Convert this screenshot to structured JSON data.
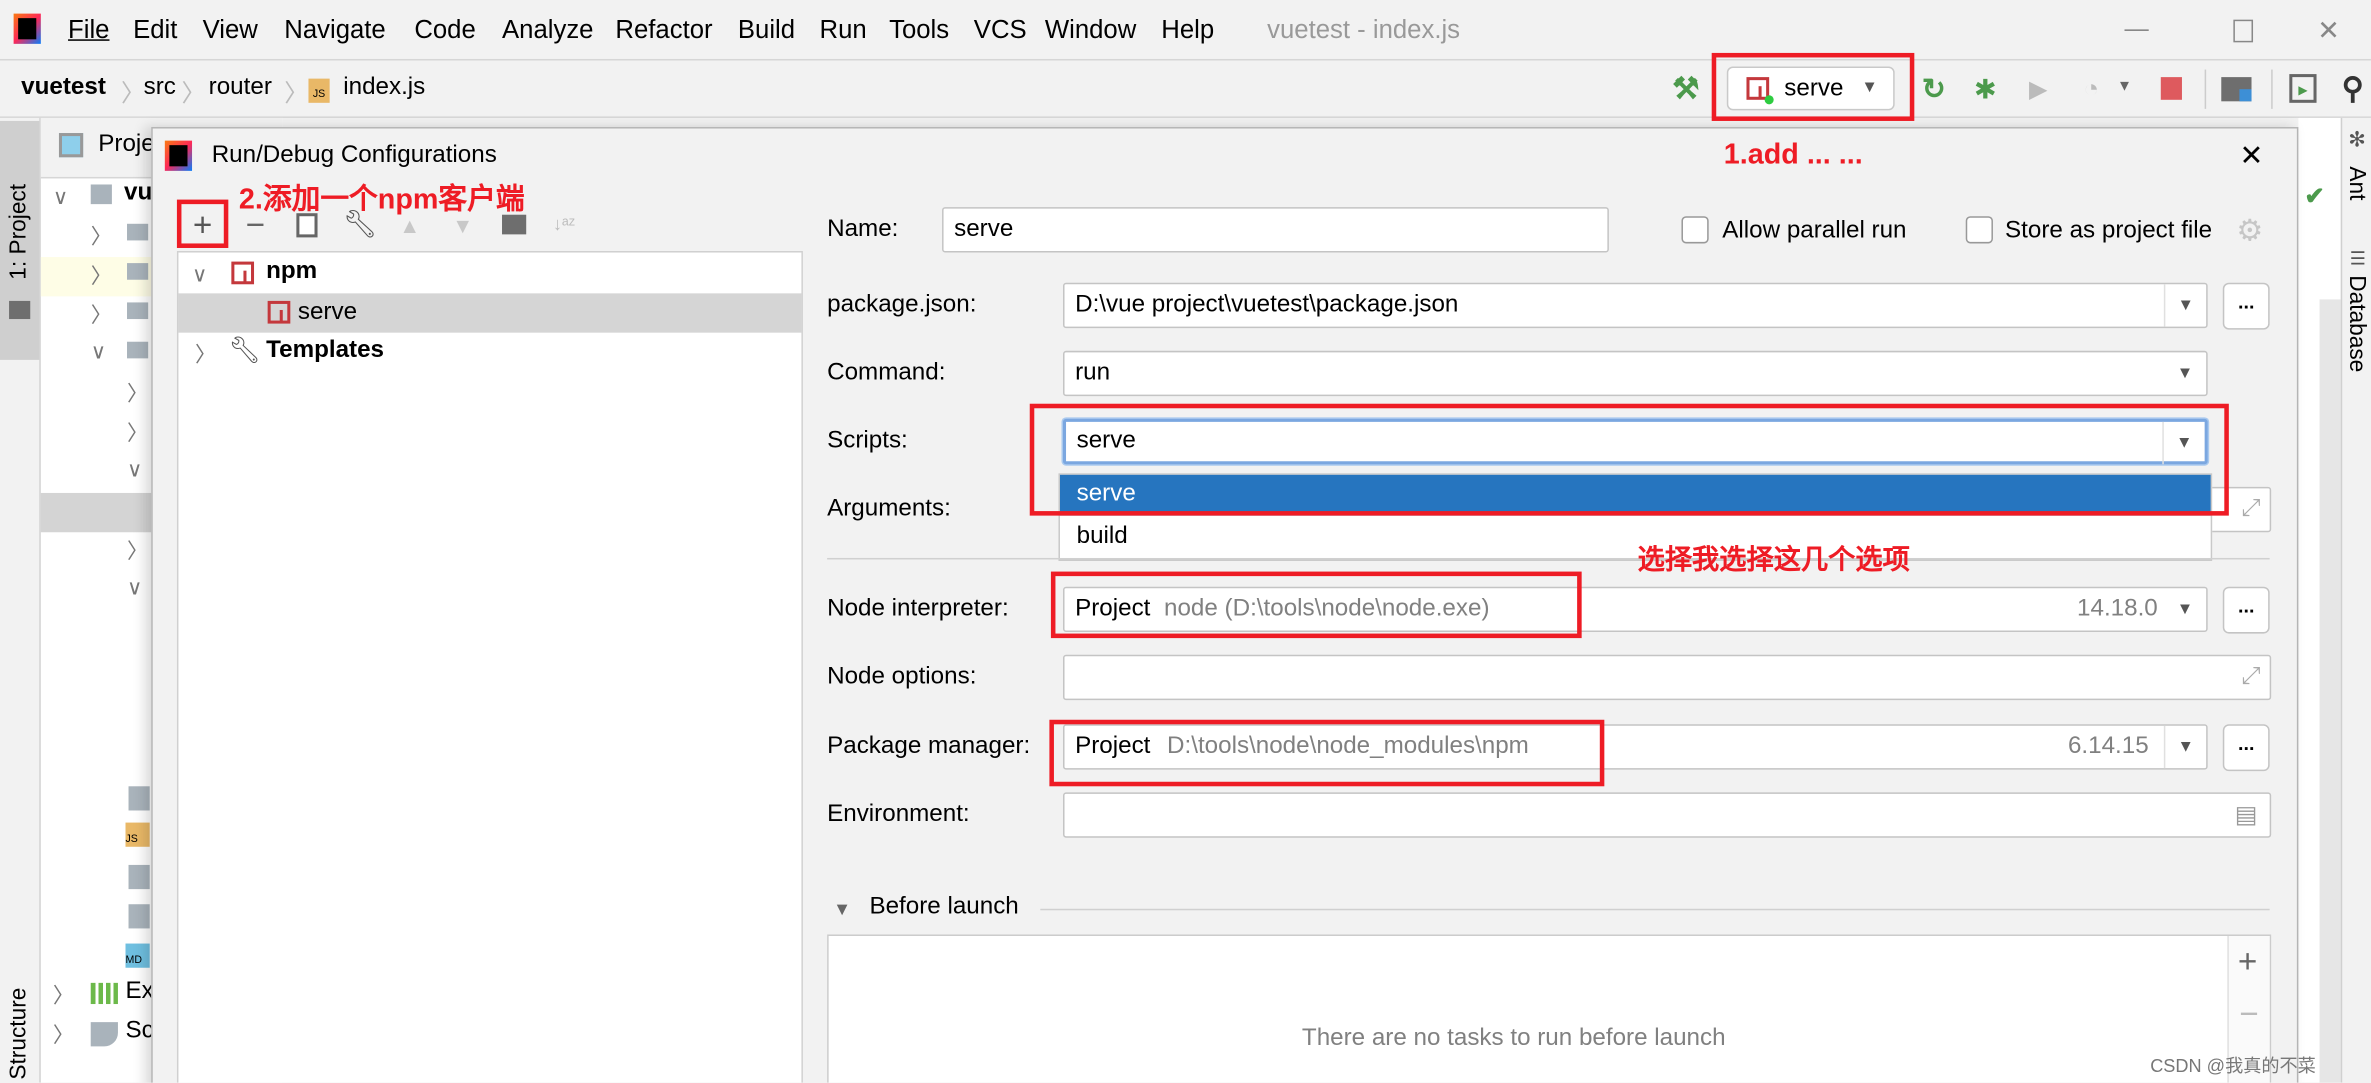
{
  "window": {
    "title": "vuetest - index.js"
  },
  "menu": [
    "File",
    "Edit",
    "View",
    "Navigate",
    "Code",
    "Analyze",
    "Refactor",
    "Build",
    "Run",
    "Tools",
    "VCS",
    "Window",
    "Help"
  ],
  "breadcrumb": [
    "vuetest",
    "src",
    "router",
    "index.js"
  ],
  "run_config": {
    "selected": "serve"
  },
  "side_tabs": {
    "project": "1: Project",
    "structure": "Structure",
    "ant": "Ant",
    "database": "Database"
  },
  "project_panel": {
    "header": "Proje",
    "root": "vu",
    "items": [
      "Ex",
      "Sc"
    ]
  },
  "dialog": {
    "title": "Run/Debug Configurations",
    "tree": {
      "group": "npm",
      "item": "serve",
      "templates": "Templates"
    },
    "name_label": "Name:",
    "name_value": "serve",
    "allow_parallel": "Allow parallel run",
    "store_project": "Store as project file",
    "package_json_label": "package.json:",
    "package_json_value": "D:\\vue project\\vuetest\\package.json",
    "command_label": "Command:",
    "command_value": "run",
    "scripts_label": "Scripts:",
    "scripts_value": "serve",
    "scripts_options": [
      "serve",
      "build"
    ],
    "arguments_label": "Arguments:",
    "node_interpreter_label": "Node interpreter:",
    "node_interpreter_kind": "Project",
    "node_interpreter_path": "node (D:\\tools\\node\\node.exe)",
    "node_version": "14.18.0",
    "node_options_label": "Node options:",
    "package_manager_label": "Package manager:",
    "package_manager_kind": "Project",
    "package_manager_path": "D:\\tools\\node\\node_modules\\npm",
    "package_manager_version": "6.14.15",
    "environment_label": "Environment:",
    "before_launch": "Before launch",
    "no_tasks": "There are no tasks to run before launch",
    "ellipsis": "..."
  },
  "annotations": {
    "step1": "1.add ... ...",
    "step2": "2.添加一个npm客户端",
    "step3": "选择我选择这几个选项"
  },
  "watermark": "CSDN @我真的不菜",
  "colors": {
    "accent": "#2675bf",
    "annotation": "#ee1c25",
    "npm": "#c4383c"
  }
}
